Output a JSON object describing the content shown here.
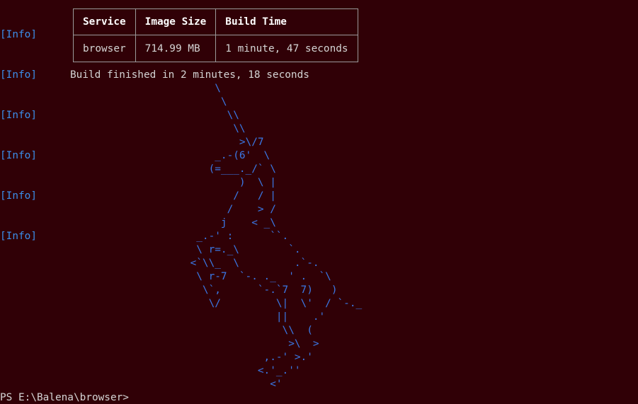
{
  "info_lines": [
    "[Info]",
    "[Info]",
    "[Info]",
    "[Info]",
    "[Info]",
    "[Info]"
  ],
  "build_table": {
    "headers": [
      "Service",
      "Image Size",
      "Build Time"
    ],
    "rows": [
      [
        "browser",
        "714.99 MB",
        "1 minute, 47 seconds"
      ]
    ]
  },
  "build_summary": "Build finished in 2 minutes, 18 seconds",
  "ascii_art": "                                   \\\n                                    \\\n                                     \\\\\n                                      \\\\\n                                       >\\/7\n                                   _.-(6'  \\\n                                  (=___._/` \\\n                                       )  \\ |\n                                      /   / |\n                                     /    > /\n                                    j    < _\\\n                                _.-' :      ``.\n                                \\ r=._\\        `.\n                               <`\\\\_  \\         .`-.\n                                \\ r-7  `-. ._  ' .  `\\\n                                 \\`,      `-.`7  7)   )\n                                  \\/         \\|  \\'  / `-._\n                                             ||    .'\n                                              \\\\  (\n                                               >\\  >\n                                           ,.-' >.'\n                                          <.'_.''\n                                            <'",
  "prompt": "PS E:\\Balena\\browser>"
}
